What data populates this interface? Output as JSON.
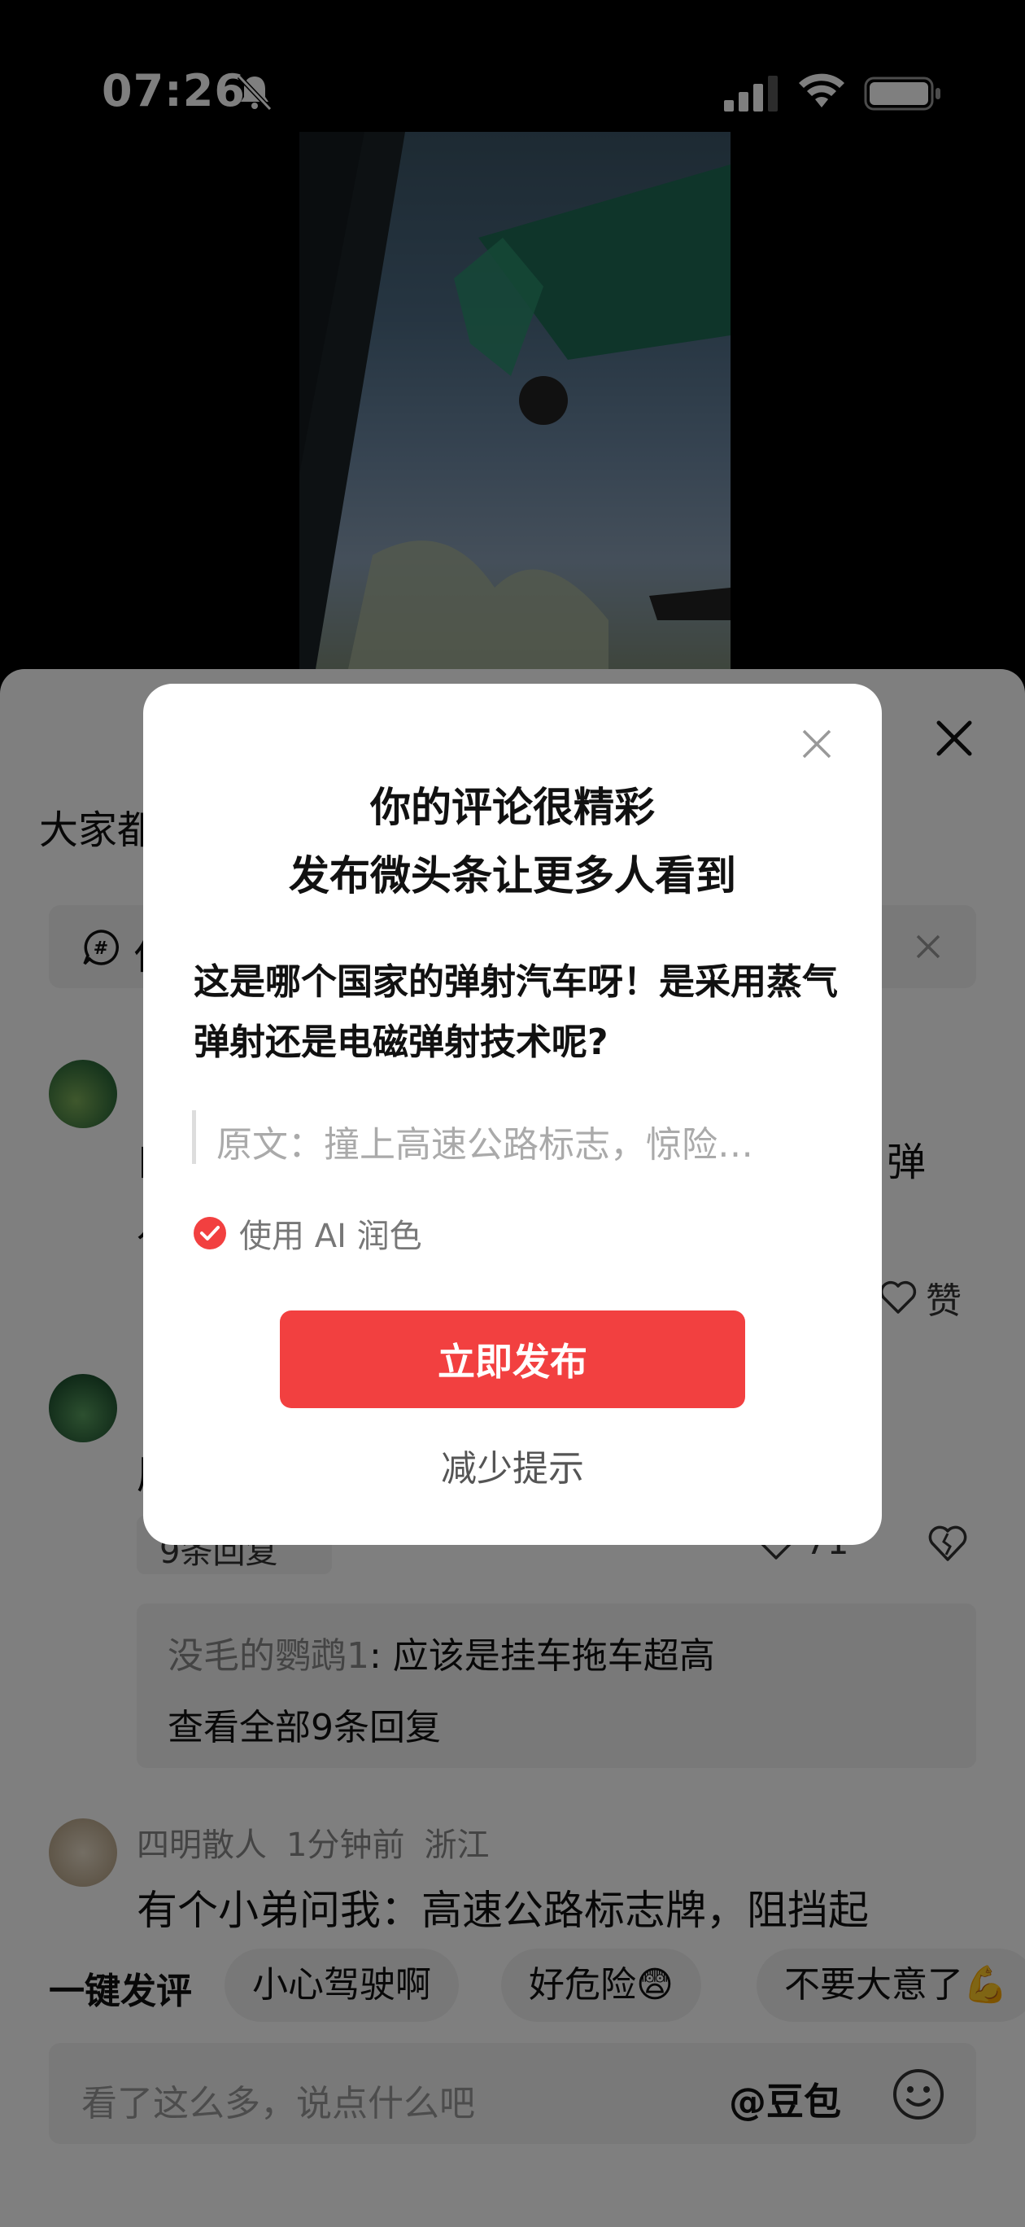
{
  "status_bar": {
    "time": "07:26",
    "icons": [
      "bell-off-icon",
      "signal-icon",
      "wifi-icon",
      "battery-icon"
    ]
  },
  "comment_sheet": {
    "title_fragment": "大家都",
    "topic_fragment": "仁",
    "comments": [
      {
        "line1_prefix": "口",
        "line1_suffix": "弹",
        "line2_prefix": "儿",
        "like_label": "赞"
      },
      {
        "line1_prefix": "刖",
        "reply_count": "9条回复",
        "like_count": "71",
        "replies": {
          "author": "没毛的鹦鹉1",
          "text": ": 应该是挂车拖车超高",
          "view_all": "查看全部9条回复"
        }
      },
      {
        "author": "四明散人",
        "time": "1分钟前",
        "location": "浙江",
        "text": "有个小弟问我：高速公路标志牌，阻挡起"
      }
    ],
    "quick_comment": {
      "label": "一键发评",
      "chips": [
        "小心驾驶啊",
        "好危险😨",
        "不要大意了💪"
      ]
    },
    "input": {
      "placeholder": "看了这么多，说点什么吧",
      "at_label": "@豆包"
    }
  },
  "dialog": {
    "title_line1": "你的评论很精彩",
    "title_line2": "发布微头条让更多人看到",
    "comment": "这是哪个国家的弹射汽车呀！是采用蒸气弹射还是电磁弹射技术呢?",
    "original_text": "原文：撞上高速公路标志，惊险…",
    "ai_polish_label": "使用 AI 润色",
    "publish_button": "立即发布",
    "less_prompt": "减少提示"
  },
  "colors": {
    "accent_red": "#f24040",
    "dim_overlay": "rgba(0,0,0,0.5)"
  }
}
